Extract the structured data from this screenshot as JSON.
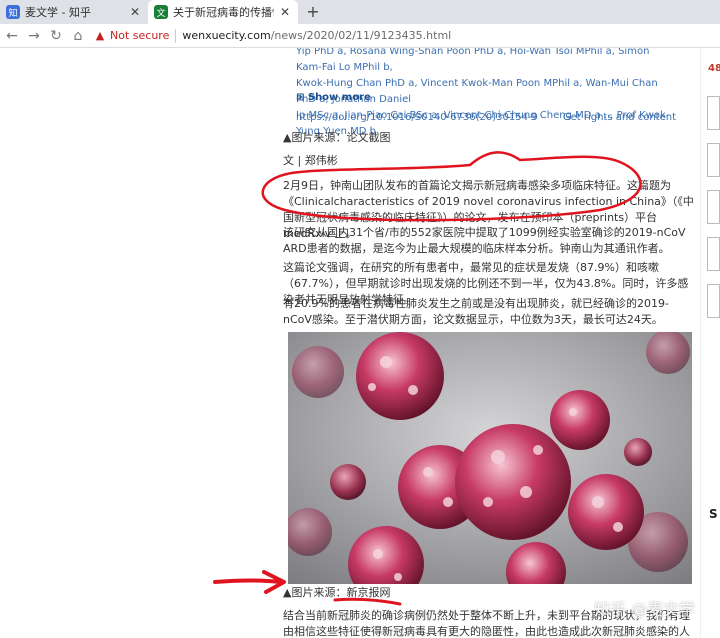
{
  "tabs": [
    {
      "title": "麦文学 - 知乎",
      "favicon": "zhihu-favicon",
      "active": false
    },
    {
      "title": "关于新冠病毒的传播性，止",
      "favicon": "wenxuecity-favicon",
      "active": true
    }
  ],
  "toolbar": {
    "security_label": "Not secure",
    "url_host": "wenxuecity.com",
    "url_path": "/news/2020/02/11/9123435.html"
  },
  "article": {
    "authors_line1": "Yip PhD a, Rosana Wing-Shan Poon PhD a, Hoi-Wah Tsoi MPhil a, Simon Kam-Fai Lo MPhil b,",
    "authors_line2": "Kwok-Hung Chan PhD a, Vincent Kwok-Man Poon MPhil a, Wan-Mui Chan PhD a, Jonathan Daniel",
    "authors_line3": "Ip MSc a, Jian-Piao Cai BSc a, Vincent Chi-Chung Cheng MD a ... Prof Kwok-Yung Yuen MD b",
    "show_more": "⊞ Show more",
    "doi": "https://doi.org/10.1016/S0140-6736(20)30154-9",
    "rights": "Get rights and content",
    "caption1": "▲图片来源：论文截图",
    "author": "文 | 郑伟彬",
    "p1": "2月9日，钟南山团队发布的首篇论文揭示新冠病毒感染多项临床特征。这篇题为《Clinicalcharacteristics of 2019 novel coronavirus infection in China》（《中国新型冠状病毒感染的临床特征》）的论文，发布在预印本（preprints）平台medRxiv 上。",
    "p2": "该研究从国内31个省/市的552家医院中提取了1099例经实验室确诊的2019-nCoV ARD患者的数据，是迄今为止最大规模的临床样本分析。钟南山为其通讯作者。",
    "p3": "这篇论文强调，在研究的所有患者中，最常见的症状是发烧（87.9%）和咳嗽（67.7%），但早期就诊时出现发烧的比例还不到一半，仅为43.8%。同时，许多感染者并无明显放射学特征。",
    "p4": "有20.9%的患者在病毒性肺炎发生之前或是没有出现肺炎，就已经确诊的2019-nCoV感染。至于潜伏期方面，论文数据显示，中位数为3天，最长可达24天。",
    "caption2": "▲图片来源：新京报网",
    "p5": "结合当前新冠肺炎的确诊病例仍然处于整体不断上升，未到平台期的现状，我们有理由相信这些特征使得新冠病毒具有更大的隐匿性，由此也造成此次新冠肺炎感染的人数明显比SARS要多，而非其"
  },
  "sidebar": {
    "number": "48",
    "letter": "S"
  },
  "watermark": "知乎 @麦文学",
  "colors": {
    "link": "#3a6fb0",
    "warning": "#c5221f",
    "annotation": "#e0141e"
  }
}
